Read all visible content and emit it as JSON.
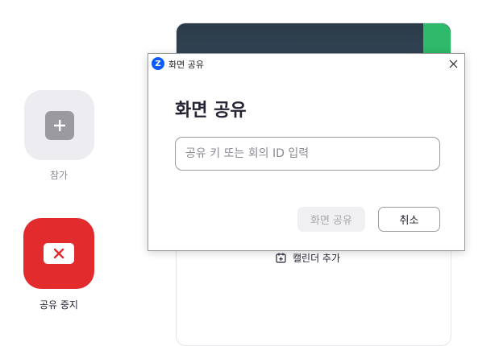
{
  "left_actions": {
    "join": {
      "label": "참가",
      "icon": "plus-icon"
    },
    "stop_share": {
      "label": "공유 중지",
      "icon": "close-icon",
      "color": "#e12b2d"
    }
  },
  "background_panel": {
    "calendar_label": "캘린더 추가",
    "calendar_icon": "calendar-add-icon"
  },
  "dialog": {
    "window_title": "화면 공유",
    "app_icon_letter": "Z",
    "heading": "화면 공유",
    "input": {
      "value": "",
      "placeholder": "공유 키 또는 회의 ID 입력"
    },
    "primary_button": "화면 공유",
    "cancel_button": "취소",
    "brand_color": "#0b5cff"
  }
}
